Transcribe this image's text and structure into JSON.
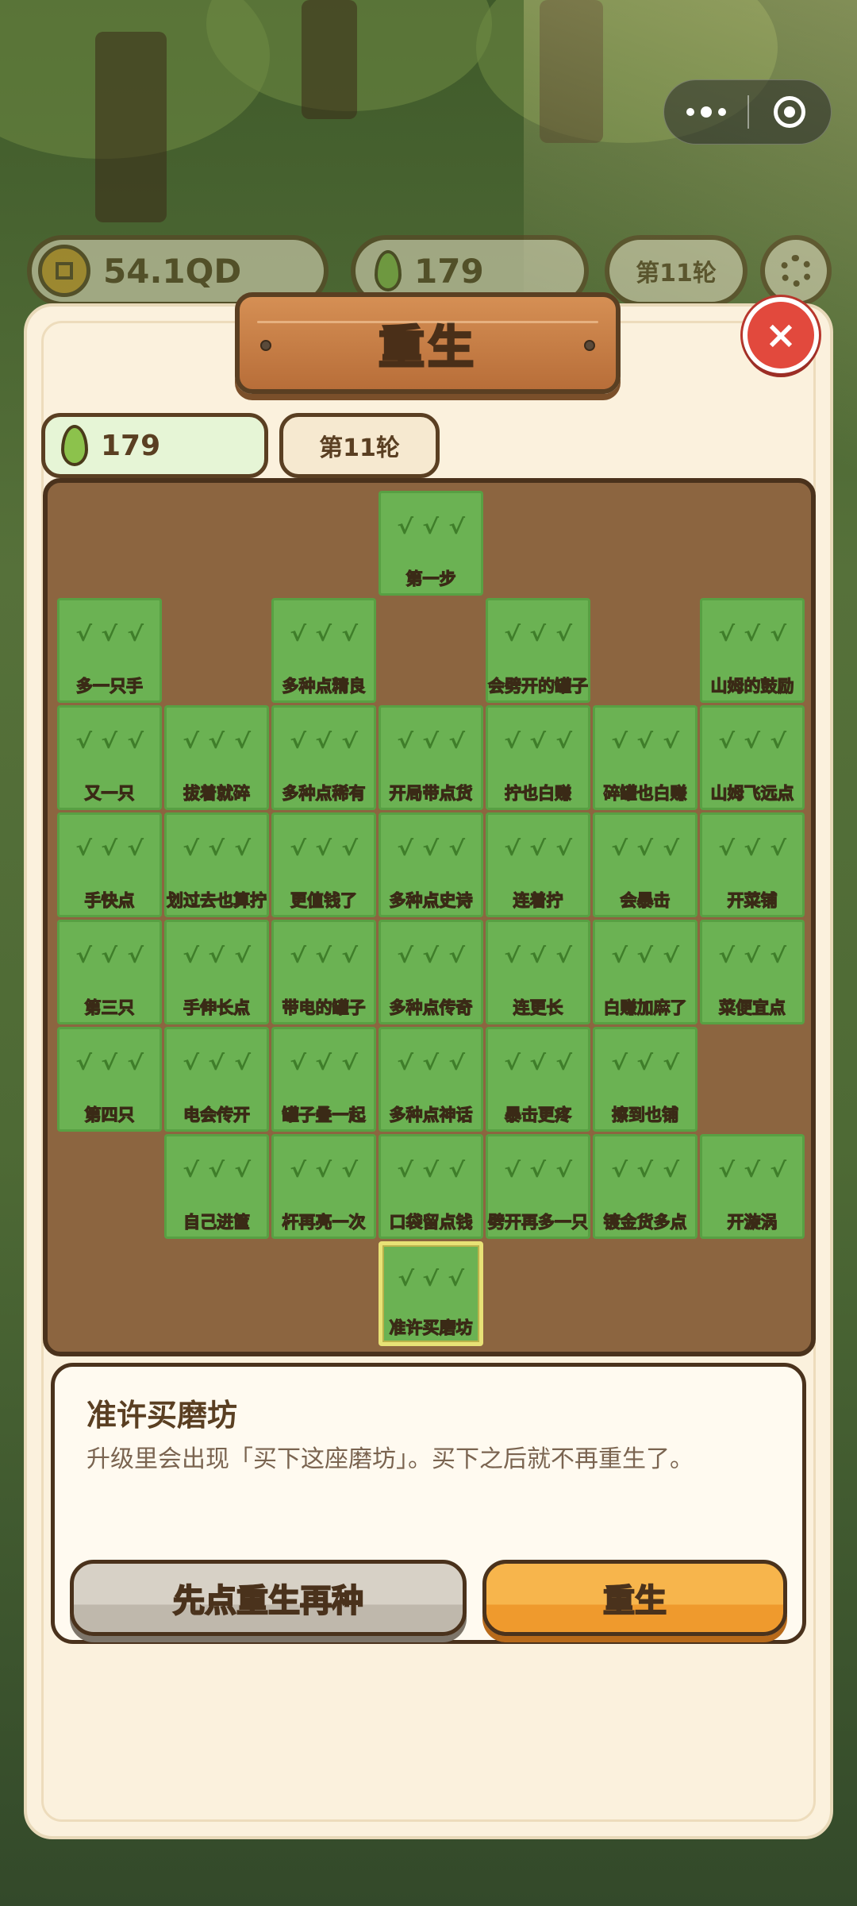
{
  "capsule": {
    "more_icon": "more-dots-icon",
    "close_icon": "target-close-icon"
  },
  "topbar": {
    "coins": "54.1QD",
    "seeds": "179",
    "round": "第11轮"
  },
  "modal": {
    "title": "重生",
    "close_label": "×",
    "seed_count": "179",
    "round_label": "第11轮"
  },
  "tree": {
    "selected": "准许买磨坊",
    "cells": [
      {
        "row": 0,
        "col": 3,
        "label": "第一步"
      },
      {
        "row": 1,
        "col": 0,
        "label": "多一只手"
      },
      {
        "row": 1,
        "col": 2,
        "label": "多种点精良"
      },
      {
        "row": 1,
        "col": 4,
        "label": "会劈开的罐子"
      },
      {
        "row": 1,
        "col": 6,
        "label": "山姆的鼓励"
      },
      {
        "row": 2,
        "col": 0,
        "label": "又一只"
      },
      {
        "row": 2,
        "col": 1,
        "label": "拔着就碎"
      },
      {
        "row": 2,
        "col": 2,
        "label": "多种点稀有"
      },
      {
        "row": 2,
        "col": 3,
        "label": "开局带点货"
      },
      {
        "row": 2,
        "col": 4,
        "label": "拧也白赚"
      },
      {
        "row": 2,
        "col": 5,
        "label": "碎罐也白赚"
      },
      {
        "row": 2,
        "col": 6,
        "label": "山姆飞远点"
      },
      {
        "row": 3,
        "col": 0,
        "label": "手快点"
      },
      {
        "row": 3,
        "col": 1,
        "label": "划过去也算拧"
      },
      {
        "row": 3,
        "col": 2,
        "label": "更值钱了"
      },
      {
        "row": 3,
        "col": 3,
        "label": "多种点史诗"
      },
      {
        "row": 3,
        "col": 4,
        "label": "连着拧"
      },
      {
        "row": 3,
        "col": 5,
        "label": "会暴击"
      },
      {
        "row": 3,
        "col": 6,
        "label": "开菜铺"
      },
      {
        "row": 4,
        "col": 0,
        "label": "第三只"
      },
      {
        "row": 4,
        "col": 1,
        "label": "手伸长点"
      },
      {
        "row": 4,
        "col": 2,
        "label": "带电的罐子"
      },
      {
        "row": 4,
        "col": 3,
        "label": "多种点传奇"
      },
      {
        "row": 4,
        "col": 4,
        "label": "连更长"
      },
      {
        "row": 4,
        "col": 5,
        "label": "白赚加麻了"
      },
      {
        "row": 4,
        "col": 6,
        "label": "菜便宜点"
      },
      {
        "row": 5,
        "col": 0,
        "label": "第四只"
      },
      {
        "row": 5,
        "col": 1,
        "label": "电会传开"
      },
      {
        "row": 5,
        "col": 2,
        "label": "罐子叠一起"
      },
      {
        "row": 5,
        "col": 3,
        "label": "多种点神话"
      },
      {
        "row": 5,
        "col": 4,
        "label": "暴击更疼"
      },
      {
        "row": 5,
        "col": 5,
        "label": "擦到也铺"
      },
      {
        "row": 6,
        "col": 1,
        "label": "自己进筐"
      },
      {
        "row": 6,
        "col": 2,
        "label": "杆再亮一次"
      },
      {
        "row": 6,
        "col": 3,
        "label": "口袋留点钱"
      },
      {
        "row": 6,
        "col": 4,
        "label": "劈开再多一只"
      },
      {
        "row": 6,
        "col": 5,
        "label": "镀金货多点"
      },
      {
        "row": 6,
        "col": 6,
        "label": "开漩涡"
      },
      {
        "row": 7,
        "col": 3,
        "label": "准许买磨坊"
      }
    ]
  },
  "info": {
    "title": "准许买磨坊",
    "desc": "升级里会出现「买下这座磨坊」。买下之后就不再重生了。"
  },
  "buttons": {
    "secondary": "先点重生再种",
    "primary": "重生"
  }
}
